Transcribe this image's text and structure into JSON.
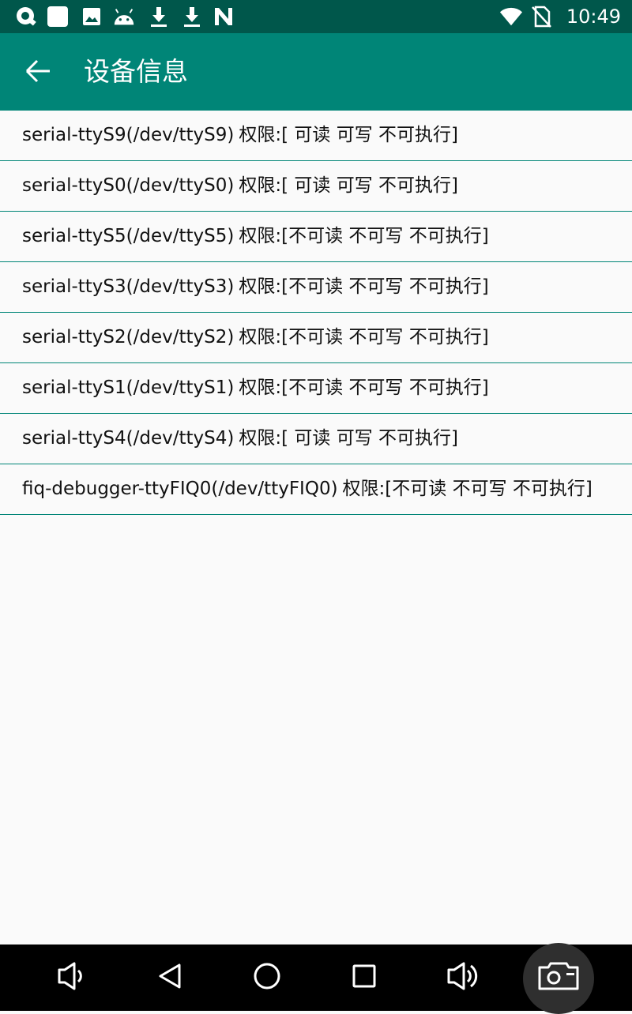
{
  "status_bar": {
    "time": "10:49",
    "left_icons": [
      "q-app-icon",
      "app-square-icon",
      "image-icon",
      "android-icon",
      "download-icon",
      "download-icon",
      "n-icon"
    ],
    "right_icons": [
      "wifi-icon",
      "no-sim-icon"
    ]
  },
  "app_bar": {
    "title": "设备信息",
    "back_icon": "arrow-left-icon",
    "color": "#008577"
  },
  "devices": [
    {
      "name": "serial-ttyS9(/dev/ttyS9)",
      "permission": "权限:[ 可读  可写 不可执行]"
    },
    {
      "name": "serial-ttyS0(/dev/ttyS0)",
      "permission": "权限:[ 可读  可写 不可执行]"
    },
    {
      "name": "serial-ttyS5(/dev/ttyS5)",
      "permission": "权限:[不可读 不可写 不可执行]"
    },
    {
      "name": "serial-ttyS3(/dev/ttyS3)",
      "permission": "权限:[不可读 不可写 不可执行]"
    },
    {
      "name": "serial-ttyS2(/dev/ttyS2)",
      "permission": "权限:[不可读 不可写 不可执行]"
    },
    {
      "name": "serial-ttyS1(/dev/ttyS1)",
      "permission": "权限:[不可读 不可写 不可执行]"
    },
    {
      "name": "serial-ttyS4(/dev/ttyS4)",
      "permission": "权限:[ 可读  可写 不可执行]"
    },
    {
      "name": "fiq-debugger-ttyFIQ0(/dev/ttyFIQ0)",
      "permission": "权限:[不可读 不可写 不可执行]"
    }
  ],
  "nav_bar": {
    "buttons": [
      "volume-down-icon",
      "back-triangle-icon",
      "home-circle-icon",
      "recents-square-icon",
      "volume-up-icon",
      "screenshot-camera-icon"
    ]
  }
}
